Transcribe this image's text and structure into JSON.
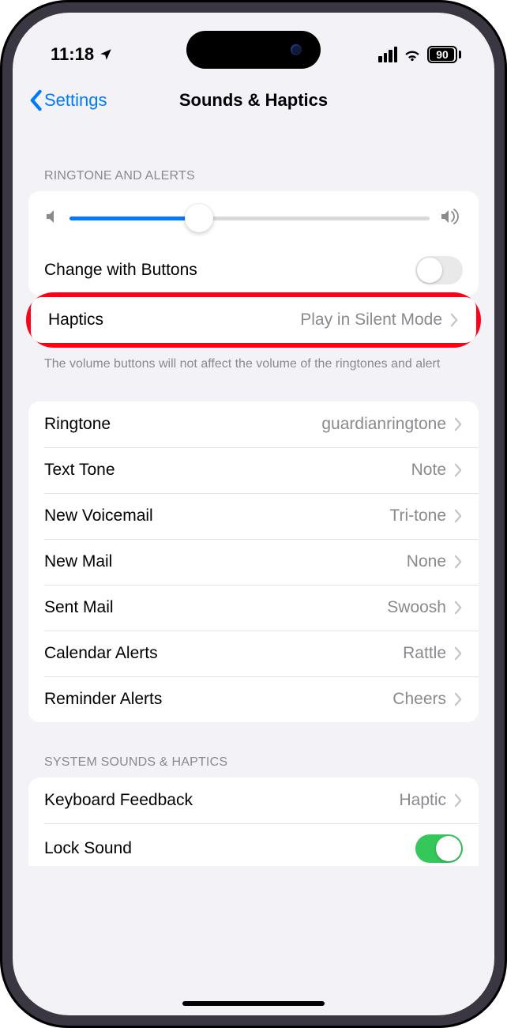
{
  "status": {
    "time": "11:18",
    "battery_pct": "90"
  },
  "nav": {
    "back": "Settings",
    "title": "Sounds & Haptics"
  },
  "sections": {
    "ringtone_alerts_header": "RINGTONE AND ALERTS",
    "change_buttons": "Change with Buttons",
    "haptics_label": "Haptics",
    "haptics_value": "Play in Silent Mode",
    "footer": "The volume buttons will not affect the volume of the ringtones and alert",
    "sounds": [
      {
        "label": "Ringtone",
        "value": "guardianringtone"
      },
      {
        "label": "Text Tone",
        "value": "Note"
      },
      {
        "label": "New Voicemail",
        "value": "Tri-tone"
      },
      {
        "label": "New Mail",
        "value": "None"
      },
      {
        "label": "Sent Mail",
        "value": "Swoosh"
      },
      {
        "label": "Calendar Alerts",
        "value": "Rattle"
      },
      {
        "label": "Reminder Alerts",
        "value": "Cheers"
      }
    ],
    "system_header": "SYSTEM SOUNDS & HAPTICS",
    "keyboard_label": "Keyboard Feedback",
    "keyboard_value": "Haptic",
    "lock_sound": "Lock Sound"
  }
}
